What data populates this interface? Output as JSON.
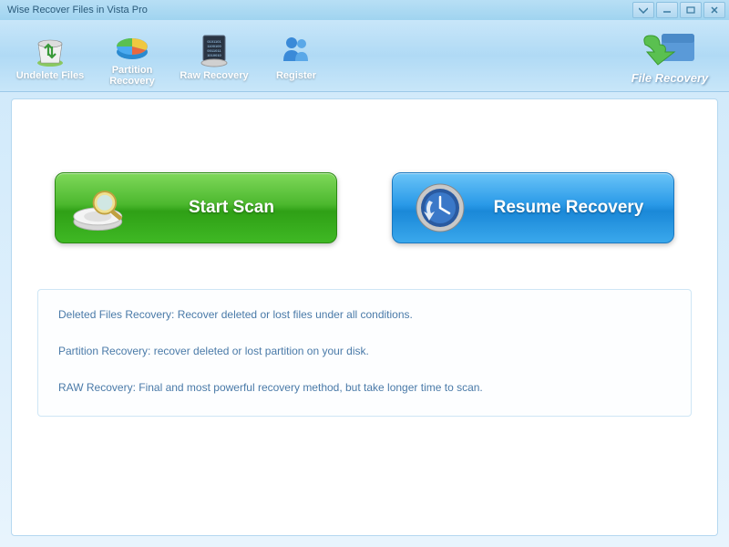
{
  "window": {
    "title": "Wise Recover Files in Vista Pro"
  },
  "toolbar": {
    "items": [
      {
        "label": "Undelete Files"
      },
      {
        "label": "Partition\nRecovery"
      },
      {
        "label": "Raw Recovery"
      },
      {
        "label": "Register"
      }
    ]
  },
  "logo": {
    "label": "File Recovery"
  },
  "main": {
    "start_scan": "Start  Scan",
    "resume_recovery": "Resume Recovery"
  },
  "info": {
    "lines": [
      "Deleted Files Recovery: Recover deleted or lost files  under all conditions.",
      "Partition Recovery: recover deleted or lost partition on your disk.",
      "RAW Recovery: Final and most powerful recovery method, but take longer time to scan."
    ]
  }
}
